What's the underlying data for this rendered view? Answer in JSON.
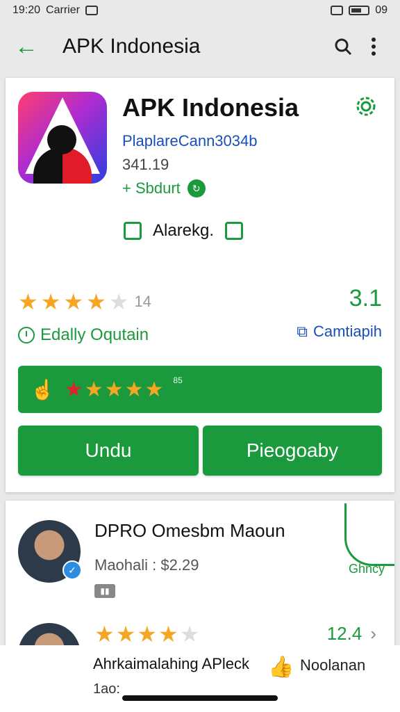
{
  "status_bar": {
    "time": "19:20",
    "carrier": "Carrier",
    "battery": "09"
  },
  "app_bar": {
    "title": "APK Indonesia",
    "back_icon": "arrow-left-icon",
    "search_icon": "search-icon",
    "menu_icon": "more-vert-icon"
  },
  "app": {
    "name": "APK Indonesia",
    "developer": "PlaplareCann3034b",
    "version": "341.19",
    "subscribe_label": "+ Sbdurt",
    "checkbox_label": "Alarekg.",
    "rating_stars": 4,
    "rating_count": "14",
    "score": "3.1",
    "daily_label": "Edally Oqutain",
    "compat_label": "Camtiapih"
  },
  "rate_bar": {
    "count": "85"
  },
  "buttons": {
    "download": "Undu",
    "program": "Pieogoaby"
  },
  "list": {
    "item1": {
      "title": "DPRO Omesbm Maoun",
      "price": "Maohali : $2.29",
      "promo_label": "Ghncy"
    },
    "item2": {
      "stars": 4,
      "score": "12.4"
    }
  },
  "banner": {
    "text": "Ahrkaimalahing APleck",
    "sub": "1ao:",
    "right_text": "Noolanan"
  },
  "colors": {
    "accent": "#1a9a3d",
    "link": "#1a4fb8",
    "star": "#f5a623"
  }
}
